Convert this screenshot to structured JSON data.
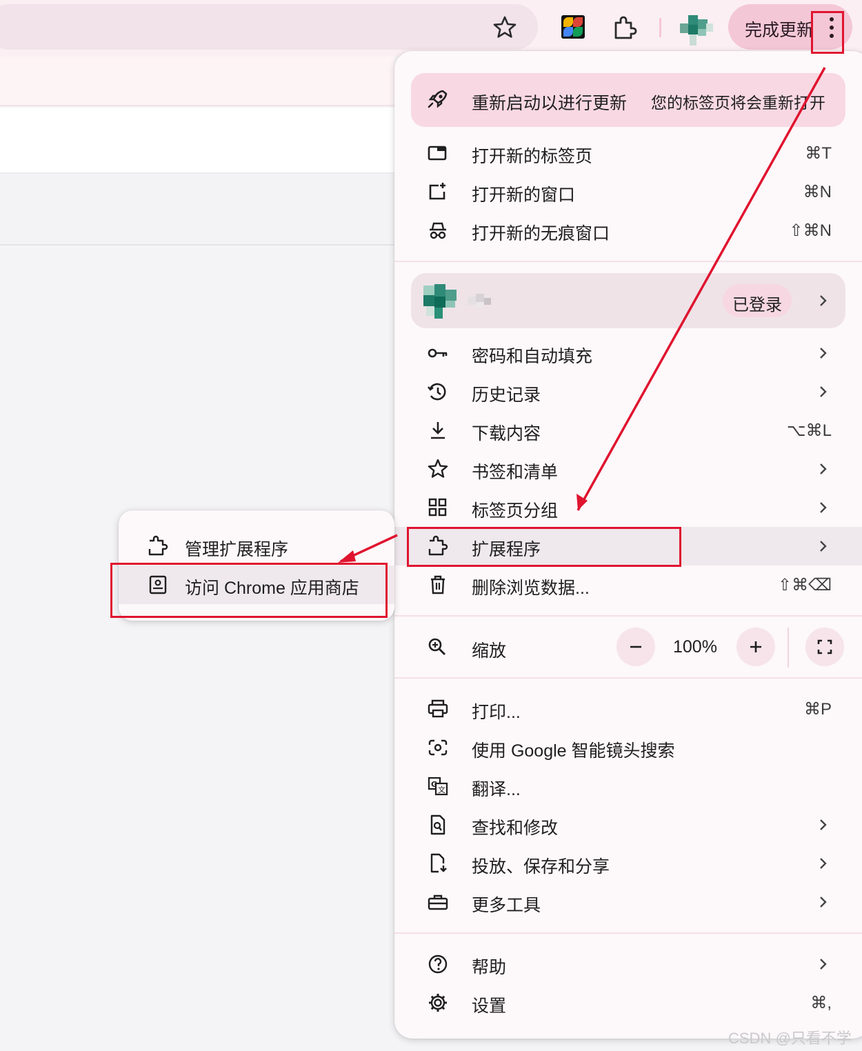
{
  "toolbar": {
    "update_button_label": "完成更新",
    "icons": [
      "star-icon",
      "extension-colorful-icon",
      "puzzle-icon",
      "avatar",
      "more-vert-icon"
    ]
  },
  "menu": {
    "restart_banner": {
      "label": "重新启动以进行更新",
      "sublabel": "您的标签页将会重新打开",
      "icon": "rocket-icon"
    },
    "group1": [
      {
        "label": "打开新的标签页",
        "shortcut": "⌘T",
        "icon": "new-tab-icon"
      },
      {
        "label": "打开新的窗口",
        "shortcut": "⌘N",
        "icon": "new-window-icon"
      },
      {
        "label": "打开新的无痕窗口",
        "shortcut": "⇧⌘N",
        "icon": "incognito-icon"
      }
    ],
    "profile": {
      "signed_in_label": "已登录"
    },
    "group2": [
      {
        "label": "密码和自动填充",
        "icon": "key-icon"
      },
      {
        "label": "历史记录",
        "icon": "history-icon"
      },
      {
        "label": "下载内容",
        "shortcut": "⌥⌘L",
        "icon": "download-icon"
      },
      {
        "label": "书签和清单",
        "icon": "star-icon"
      },
      {
        "label": "标签页分组",
        "icon": "grid-icon"
      },
      {
        "label": "扩展程序",
        "icon": "puzzle-icon"
      },
      {
        "label": "删除浏览数据...",
        "shortcut": "⇧⌘⌫",
        "icon": "trash-icon"
      }
    ],
    "zoom": {
      "label": "缩放",
      "value": "100%",
      "minus": "−",
      "plus": "+"
    },
    "group3": [
      {
        "label": "打印...",
        "shortcut": "⌘P",
        "icon": "print-icon"
      },
      {
        "label": "使用 Google 智能镜头搜索",
        "icon": "lens-icon"
      },
      {
        "label": "翻译...",
        "icon": "translate-icon"
      },
      {
        "label": "查找和修改",
        "icon": "find-icon"
      },
      {
        "label": "投放、保存和分享",
        "icon": "cast-icon"
      },
      {
        "label": "更多工具",
        "icon": "toolbox-icon"
      }
    ],
    "group4": [
      {
        "label": "帮助",
        "icon": "help-icon"
      },
      {
        "label": "设置",
        "shortcut": "⌘,",
        "icon": "gear-icon"
      }
    ]
  },
  "submenu": {
    "items": [
      {
        "label": "管理扩展程序",
        "icon": "puzzle-icon"
      },
      {
        "label": "访问 Chrome 应用商店",
        "icon": "web-store-icon"
      }
    ]
  },
  "watermark": "CSDN @只看不学",
  "colors": {
    "annotation_red": "#e0142f",
    "menu_bg": "#fdf8fa",
    "highlight": "#efe8ec",
    "update_pill": "#f4c7d6"
  }
}
